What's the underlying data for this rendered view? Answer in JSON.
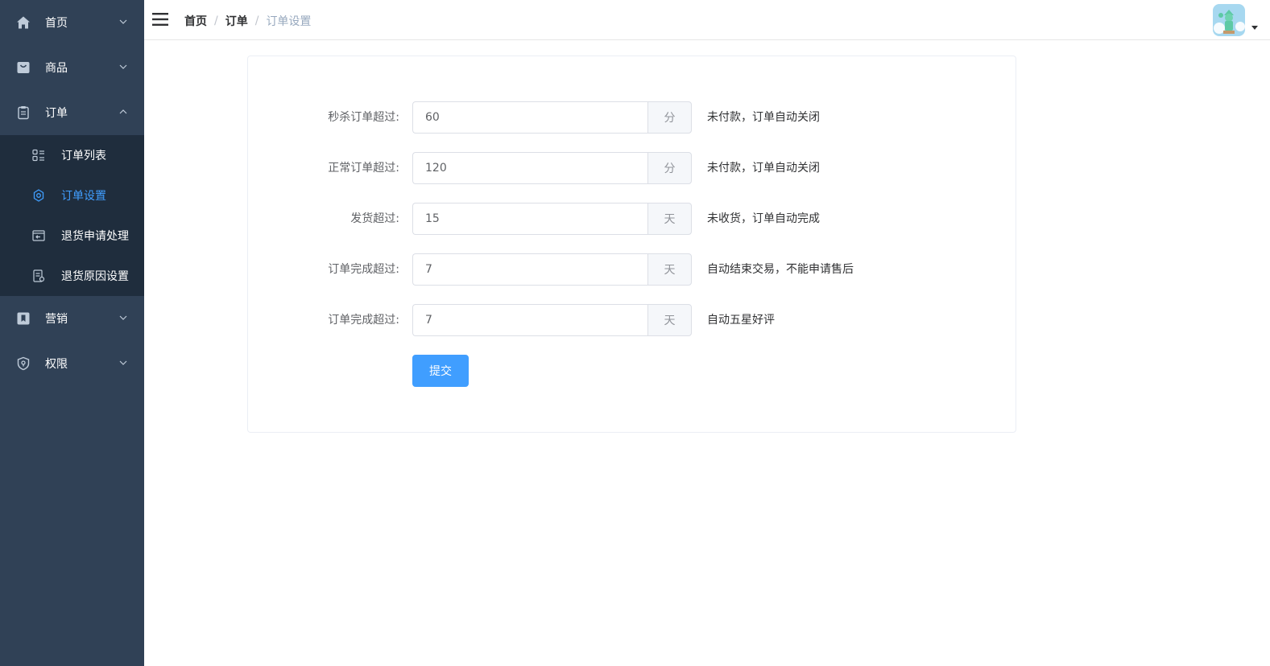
{
  "sidebar": {
    "menu": [
      {
        "label": "首页",
        "icon": "home-icon"
      },
      {
        "label": "商品",
        "icon": "bag-icon"
      },
      {
        "label": "订单",
        "icon": "clipboard-icon"
      }
    ],
    "order_submenu": [
      {
        "label": "订单列表",
        "icon": "list-icon"
      },
      {
        "label": "订单设置",
        "icon": "gear-icon",
        "active": true
      },
      {
        "label": "退货申请处理",
        "icon": "return-icon"
      },
      {
        "label": "退货原因设置",
        "icon": "document-icon"
      }
    ],
    "menu_bottom": [
      {
        "label": "营销",
        "icon": "bookmark-icon"
      },
      {
        "label": "权限",
        "icon": "shield-icon"
      }
    ]
  },
  "breadcrumb": [
    "首页",
    "订单",
    "订单设置"
  ],
  "form": {
    "rows": [
      {
        "label": "秒杀订单超过:",
        "value": "60",
        "unit": "分",
        "tip": "未付款，订单自动关闭"
      },
      {
        "label": "正常订单超过:",
        "value": "120",
        "unit": "分",
        "tip": "未付款，订单自动关闭"
      },
      {
        "label": "发货超过:",
        "value": "15",
        "unit": "天",
        "tip": "未收货，订单自动完成"
      },
      {
        "label": "订单完成超过:",
        "value": "7",
        "unit": "天",
        "tip": "自动结束交易，不能申请售后"
      },
      {
        "label": "订单完成超过:",
        "value": "7",
        "unit": "天",
        "tip": "自动五星好评"
      }
    ],
    "submit_label": "提交"
  },
  "colors": {
    "sidebar_bg": "#304156",
    "submenu_bg": "#1f2d3d",
    "accent": "#409eff"
  }
}
